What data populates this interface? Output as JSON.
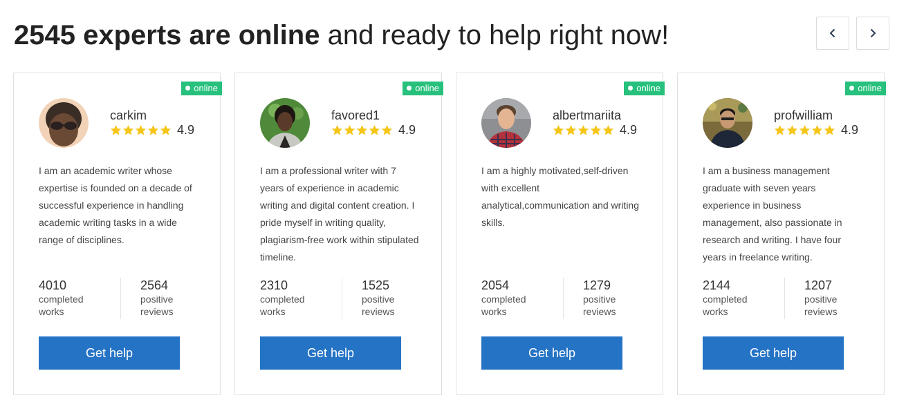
{
  "header": {
    "title_bold": "2545 experts are online",
    "title_rest": " and ready to help right now!",
    "prev_icon": "chevron-left-icon",
    "next_icon": "chevron-right-icon"
  },
  "colors": {
    "online_badge": "#27c07d",
    "button": "#2573c5",
    "star": "#f5c518"
  },
  "experts": [
    {
      "status": "online",
      "name": "carkim",
      "rating": "4.9",
      "stars": 5,
      "bio": "I am an academic writer whose expertise is founded on a decade of successful experience in handling academic writing tasks in a wide range of disciplines.",
      "completed": "4010",
      "completed_label": "completed works",
      "reviews": "2564",
      "reviews_label": "positive reviews",
      "button": "Get help",
      "avatar_icon": "avatar-photo-icon"
    },
    {
      "status": "online",
      "name": "favored1",
      "rating": "4.9",
      "stars": 5,
      "bio": "I am a professional writer with 7 years of experience in academic writing and digital content creation. I pride myself in writing quality, plagiarism-free work within stipulated timeline.",
      "completed": "2310",
      "completed_label": "completed works",
      "reviews": "1525",
      "reviews_label": "positive reviews",
      "button": "Get help",
      "avatar_icon": "avatar-photo-icon"
    },
    {
      "status": "online",
      "name": "albertmariita",
      "rating": "4.9",
      "stars": 5,
      "bio": "I am a highly motivated,self-driven with excellent analytical,communication and writing skills.",
      "completed": "2054",
      "completed_label": "completed works",
      "reviews": "1279",
      "reviews_label": "positive reviews",
      "button": "Get help",
      "avatar_icon": "avatar-photo-icon"
    },
    {
      "status": "online",
      "name": "profwilliam",
      "rating": "4.9",
      "stars": 5,
      "bio": "I am a business management graduate with seven years experience in business management, also passionate in research and writing. I have four years in freelance writing.",
      "completed": "2144",
      "completed_label": "completed works",
      "reviews": "1207",
      "reviews_label": "positive reviews",
      "button": "Get help",
      "avatar_icon": "avatar-photo-icon"
    }
  ]
}
